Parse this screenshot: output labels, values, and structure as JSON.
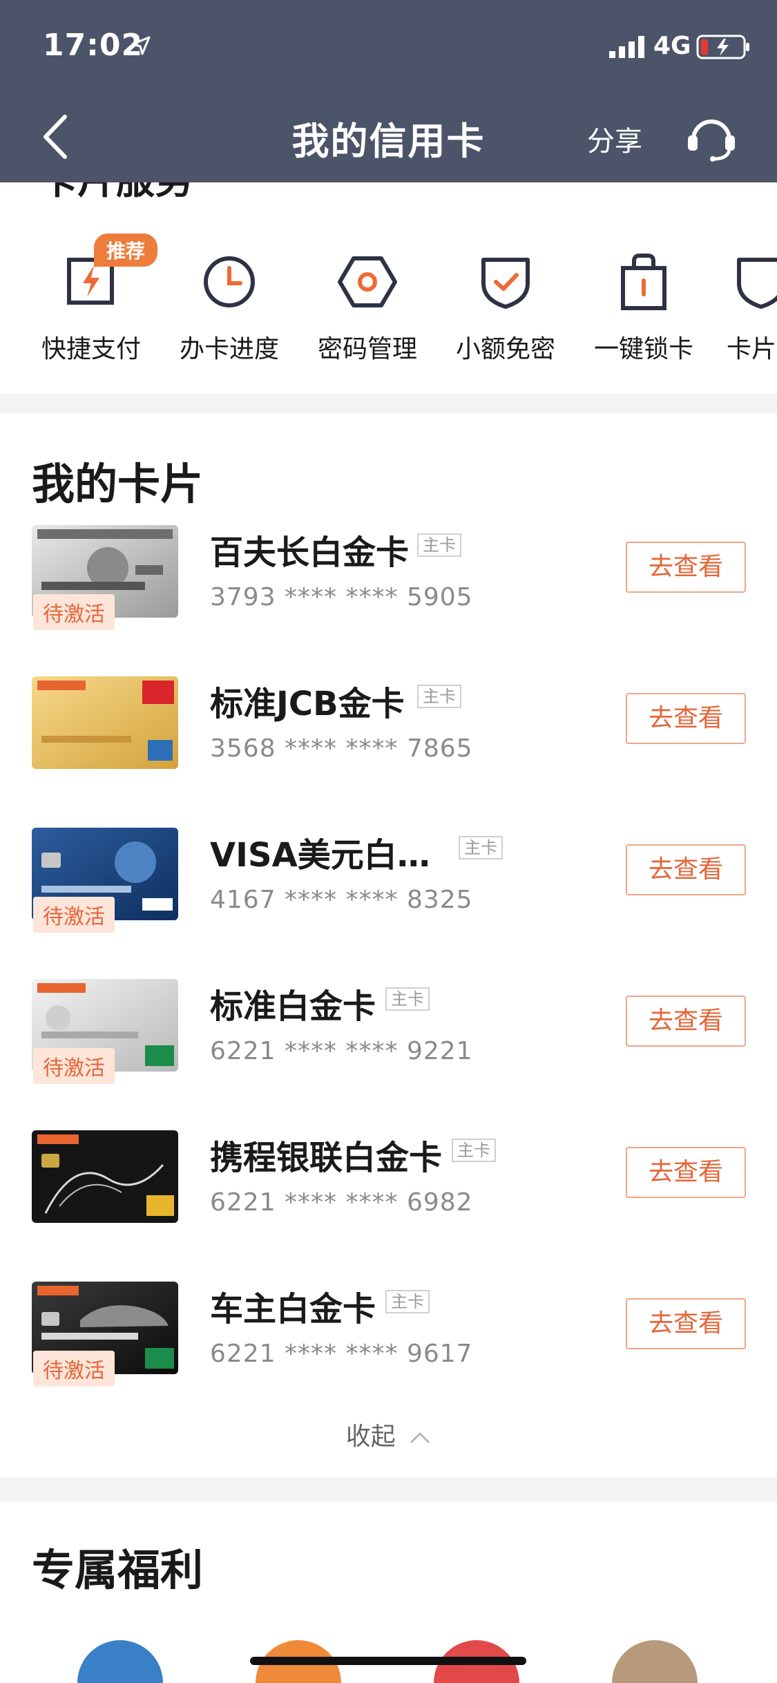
{
  "status": {
    "time": "17:02",
    "network": "4G"
  },
  "header": {
    "title": "我的信用卡",
    "share": "分享"
  },
  "services": {
    "section_title": "卡片服务",
    "hot_tag": "推荐",
    "items": [
      {
        "label": "快捷支付",
        "icon": "lightning-icon"
      },
      {
        "label": "办卡进度",
        "icon": "clock-icon"
      },
      {
        "label": "密码管理",
        "icon": "hexagon-icon"
      },
      {
        "label": "小额免密",
        "icon": "shield-check-icon"
      },
      {
        "label": "一键锁卡",
        "icon": "lock-bag-icon"
      },
      {
        "label": "卡片",
        "icon": "shield-icon"
      }
    ]
  },
  "cards": {
    "title": "我的卡片",
    "main_tag": "主卡",
    "view_label": "去查看",
    "inactive_label": "待激活",
    "items": [
      {
        "name": "百夫长白金卡",
        "number": "3793 **** **** 5905",
        "inactive": true
      },
      {
        "name": "标准JCB金卡",
        "number": "3568 **** **** 7865",
        "inactive": false
      },
      {
        "name": "VISA美元白…",
        "number": "4167 **** **** 8325",
        "inactive": true
      },
      {
        "name": "标准白金卡",
        "number": "6221 **** **** 9221",
        "inactive": true
      },
      {
        "name": "携程银联白金卡",
        "number": "6221 **** **** 6982",
        "inactive": false
      },
      {
        "name": "车主白金卡",
        "number": "6221 **** **** 9617",
        "inactive": true
      }
    ],
    "collapse": "收起"
  },
  "benefits": {
    "title": "专属福利"
  },
  "colors": {
    "header_bg": "#4b5468",
    "accent": "#e4663a"
  }
}
